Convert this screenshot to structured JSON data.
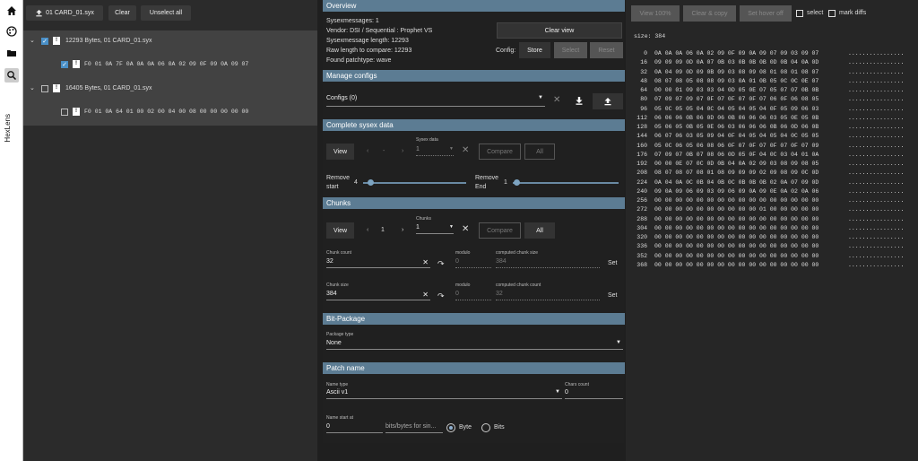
{
  "app": {
    "name": "HexLens"
  },
  "toolbar": {
    "upload_label": "01 CARD_01.syx",
    "clear_label": "Clear",
    "unselect_label": "Unselect all"
  },
  "tree": [
    {
      "label": "12293 Bytes, 01 CARD_01.syx",
      "checked": true,
      "child": {
        "hex": "F0 01 0A 7F 0A 0A 0A 06 0A 02 09 0F 09 0A 09 07",
        "checked": true
      }
    },
    {
      "label": "16405 Bytes, 01 CARD_01.syx",
      "checked": false,
      "child": {
        "hex": "F0 01 0A 64 01 00 02 00 04 00 08 00 00 00 00 00",
        "checked": false
      }
    }
  ],
  "overview": {
    "title": "Overview",
    "lines": [
      "Sysexmessages: 1",
      "Vendor: DSI / Sequential : Prophet VS",
      "Sysexmessage length: 12293",
      "Raw length to compare: 12293",
      "Found patchtype: wave"
    ],
    "clear_view": "Clear view",
    "config_label": "Config:",
    "store": "Store",
    "select": "Select",
    "reset": "Reset"
  },
  "manage": {
    "title": "Manage configs",
    "configs_value": "Configs (0)"
  },
  "complete": {
    "title": "Complete sysex data",
    "view": "View",
    "prev": "‹",
    "dash": "-",
    "next": "›",
    "sysex_data_label": "Sysex data",
    "sysex_data_value": "1",
    "compare": "Compare",
    "all": "All",
    "remove_start_label": "Remove start",
    "remove_start_value": "4",
    "remove_end_label": "Remove End",
    "remove_end_value": "1",
    "remove_start_level": 0.04,
    "remove_end_level": 0.01
  },
  "chunks": {
    "title": "Chunks",
    "view": "View",
    "prev": "‹",
    "page": "1",
    "next": "›",
    "chunks_label": "Chunks",
    "chunks_value": "1",
    "compare": "Compare",
    "all": "All",
    "count_label": "Chunk count",
    "count_value": "32",
    "modulo_label": "modulo",
    "modulo1_value": "0",
    "computed_size_label": "computed chunk size",
    "computed_size_value": "384",
    "set": "Set",
    "size_label": "Chunk size",
    "size_value": "384",
    "modulo2_value": "0",
    "computed_count_label": "computed chunk count",
    "computed_count_value": "32"
  },
  "bitpackage": {
    "title": "Bit-Package",
    "type_label": "Package type",
    "type_value": "None"
  },
  "patchname": {
    "title": "Patch name",
    "name_type_label": "Name type",
    "name_type_value": "Ascii v1",
    "chars_label": "Chars count",
    "chars_value": "0",
    "start_label": "Name start at",
    "start_value": "0",
    "bits_placeholder": "bits/bytes for sin...",
    "byte": "Byte",
    "bits": "Bits"
  },
  "hexview": {
    "view100": "View 100%",
    "clear_copy": "Clear & copy",
    "set_hover_off": "Set hover off",
    "select_label": "select",
    "mark_diffs_label": "mark diffs",
    "size_line": "size: 384",
    "rows": [
      {
        "off": "0",
        "hex": "0A 0A 0A 06 0A 02 09 0F 09 0A 09 07 09 03 09 07",
        "ascii": "................"
      },
      {
        "off": "16",
        "hex": "09 09 09 0D 0A 07 0B 03 0B 0B 0B 0D 0B 04 0A 0D",
        "ascii": "................"
      },
      {
        "off": "32",
        "hex": "0A 04 09 0D 09 0B 09 03 08 09 08 01 08 01 08 07",
        "ascii": "................"
      },
      {
        "off": "48",
        "hex": "08 07 08 05 08 08 09 03 0A 01 0B 05 0C 0C 0E 07",
        "ascii": "................"
      },
      {
        "off": "64",
        "hex": "00 00 01 09 03 03 04 0D 05 0E 07 05 07 07 0B 0B",
        "ascii": "................"
      },
      {
        "off": "80",
        "hex": "07 09 07 09 07 0F 07 0F 07 0F 07 06 0F 06 08 05",
        "ascii": "................"
      },
      {
        "off": "96",
        "hex": "05 0C 05 05 04 0C 04 05 04 05 04 0F 05 09 06 03",
        "ascii": "................"
      },
      {
        "off": "112",
        "hex": "06 06 06 0B 06 0D 06 0B 06 06 06 03 05 0E 05 0B",
        "ascii": "................"
      },
      {
        "off": "128",
        "hex": "05 06 05 0B 05 0E 06 03 06 06 06 0B 06 0D 06 0B",
        "ascii": "................"
      },
      {
        "off": "144",
        "hex": "06 07 06 03 05 09 04 0F 04 05 04 05 04 0C 05 05",
        "ascii": "................"
      },
      {
        "off": "160",
        "hex": "05 0C 06 05 06 08 06 0F 07 0F 07 0F 07 0F 07 09",
        "ascii": "................"
      },
      {
        "off": "176",
        "hex": "07 09 07 0B 07 08 06 0D 05 0F 04 0C 03 04 01 0A",
        "ascii": "................"
      },
      {
        "off": "192",
        "hex": "00 00 0E 07 0C 0D 0B 04 0A 02 09 03 08 09 08 05",
        "ascii": "................"
      },
      {
        "off": "208",
        "hex": "08 07 08 07 08 01 08 09 09 09 02 09 08 09 0C 0D",
        "ascii": "................"
      },
      {
        "off": "224",
        "hex": "0A 04 0A 0C 0B 04 0B 0C 0B 0B 0B 02 0A 07 09 0D",
        "ascii": "................"
      },
      {
        "off": "240",
        "hex": "09 0A 09 06 09 03 09 06 09 0A 09 0E 0A 02 0A 06",
        "ascii": "................"
      },
      {
        "off": "256",
        "hex": "00 00 00 00 00 00 00 00 00 00 00 00 00 00 00 00",
        "ascii": "................"
      },
      {
        "off": "272",
        "hex": "00 00 00 00 00 00 00 00 00 00 01 00 00 00 00 00",
        "ascii": "................"
      },
      {
        "off": "288",
        "hex": "00 00 00 00 00 00 00 00 00 00 00 00 00 00 00 00",
        "ascii": "................"
      },
      {
        "off": "304",
        "hex": "00 00 00 00 00 00 00 00 00 00 00 00 00 00 00 00",
        "ascii": "................"
      },
      {
        "off": "320",
        "hex": "00 00 00 00 00 00 00 00 00 00 00 00 00 00 00 00",
        "ascii": "................"
      },
      {
        "off": "336",
        "hex": "00 00 00 00 00 00 00 00 00 00 00 00 00 00 00 00",
        "ascii": "................"
      },
      {
        "off": "352",
        "hex": "00 00 00 00 00 00 00 00 00 00 00 00 00 00 00 00",
        "ascii": "................"
      },
      {
        "off": "368",
        "hex": "00 00 00 00 00 00 00 00 00 00 00 00 00 00 00 00",
        "ascii": "................"
      }
    ]
  },
  "colors": {
    "section_header": "#5c7c93",
    "checkbox_on": "#4a90c8"
  },
  "icons": [
    "home-icon",
    "palette-icon",
    "folder-icon",
    "search-icon",
    "upload-icon",
    "close-icon",
    "download-icon",
    "chevron-down-icon",
    "redo-icon"
  ]
}
